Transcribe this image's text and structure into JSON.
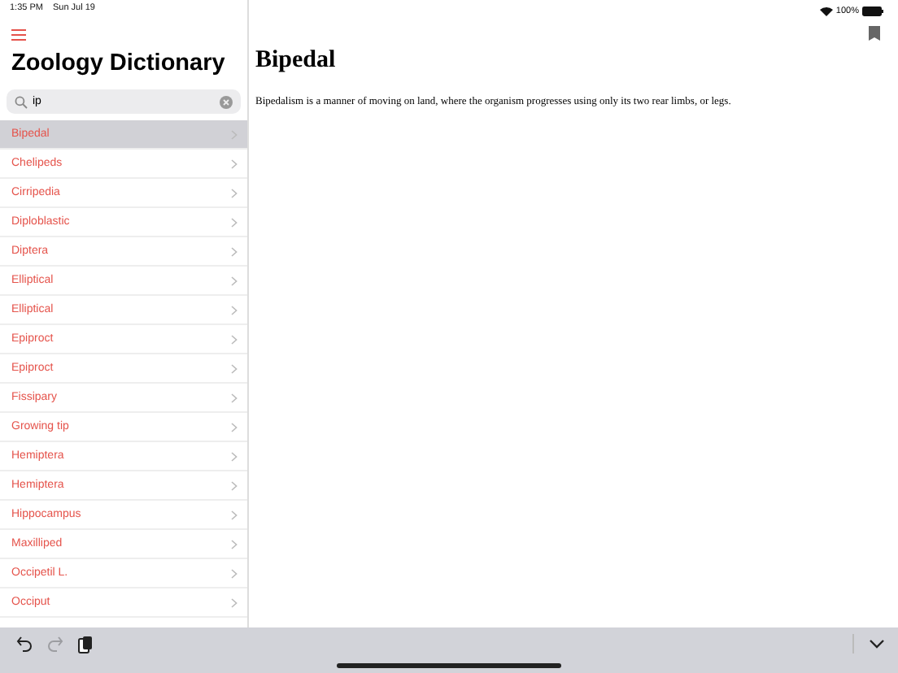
{
  "status_bar": {
    "time": "1:35 PM",
    "date": "Sun Jul 19",
    "battery": "100%"
  },
  "sidebar": {
    "title": "Zoology Dictionary",
    "search": {
      "value": "ip"
    },
    "items": [
      {
        "label": "Bipedal",
        "selected": true
      },
      {
        "label": "Chelipeds",
        "selected": false
      },
      {
        "label": "Cirripedia",
        "selected": false
      },
      {
        "label": "Diploblastic",
        "selected": false
      },
      {
        "label": "Diptera",
        "selected": false
      },
      {
        "label": "Elliptical",
        "selected": false
      },
      {
        "label": "Elliptical",
        "selected": false
      },
      {
        "label": "Epiproct",
        "selected": false
      },
      {
        "label": "Epiproct",
        "selected": false
      },
      {
        "label": "Fissipary",
        "selected": false
      },
      {
        "label": "Growing tip",
        "selected": false
      },
      {
        "label": "Hemiptera",
        "selected": false
      },
      {
        "label": "Hemiptera",
        "selected": false
      },
      {
        "label": "Hippocampus",
        "selected": false
      },
      {
        "label": "Maxilliped",
        "selected": false
      },
      {
        "label": "Occipetil L.",
        "selected": false
      },
      {
        "label": "Occiput",
        "selected": false
      }
    ]
  },
  "detail": {
    "heading": "Bipedal",
    "definition": "Bipedalism is a manner of moving on land, where the organism progresses using only its two rear limbs, or legs."
  },
  "toolbar": {
    "redo_disabled": true
  }
}
